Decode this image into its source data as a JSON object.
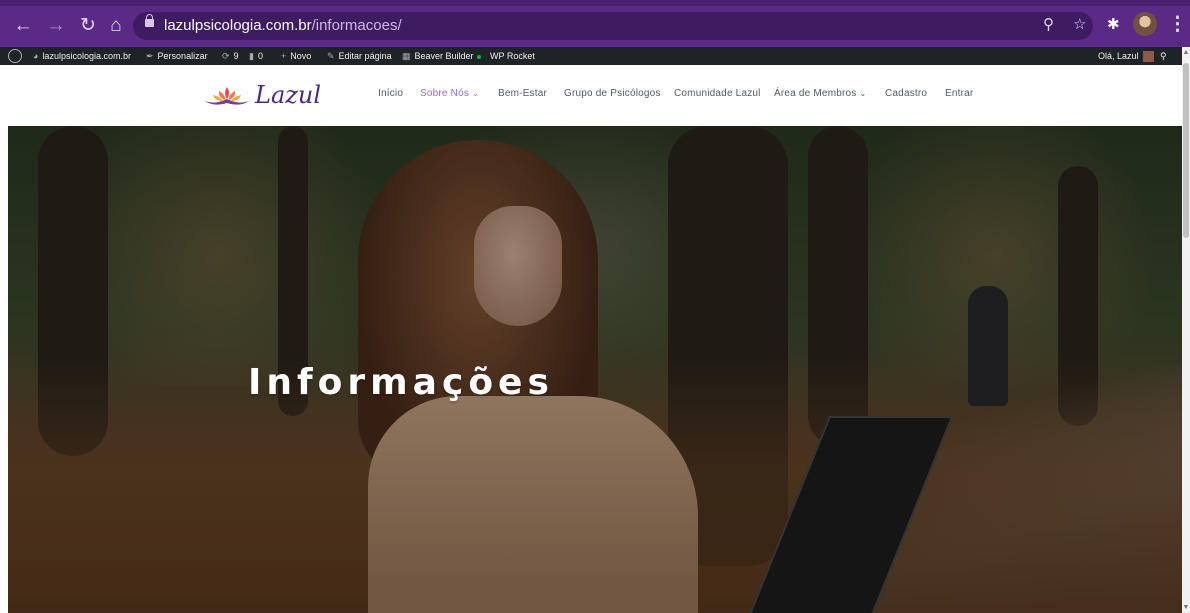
{
  "browser": {
    "url_host": "lazulpsicologia.com.br",
    "url_path": "/informacoes/",
    "icons": {
      "back": "arrow-left-icon",
      "forward": "arrow-right-icon",
      "reload": "reload-icon",
      "home": "home-icon",
      "zoom": "zoom-icon",
      "bookmark": "star-icon",
      "extensions": "puzzle-icon",
      "menu": "kebab-menu-icon"
    },
    "colors": {
      "frame": "#5b2a86",
      "omnibox": "#3f1b62"
    }
  },
  "adminbar": {
    "site": "lazulpsicologia.com.br",
    "customize": "Personalizar",
    "updates": "9",
    "comments": "0",
    "new": "Novo",
    "edit_page": "Editar página",
    "beaver_builder": "Beaver Builder",
    "wp_rocket": "WP Rocket",
    "greeting": "Olá, Lazul"
  },
  "site": {
    "logo_text": "Lazul",
    "menu": [
      {
        "label": "Início"
      },
      {
        "label": "Sobre Nós",
        "active": true,
        "has_dropdown": true
      },
      {
        "label": "Bem-Estar"
      },
      {
        "label": "Grupo de Psicólogos"
      },
      {
        "label": "Comunidade Lazul"
      },
      {
        "label": "Área de Membros",
        "has_dropdown": true
      },
      {
        "label": "Cadastro"
      },
      {
        "label": "Entrar"
      }
    ],
    "accent_color": "#9b6bc4",
    "logo_color": "#4b2c7c"
  },
  "hero": {
    "title": "Informações"
  }
}
